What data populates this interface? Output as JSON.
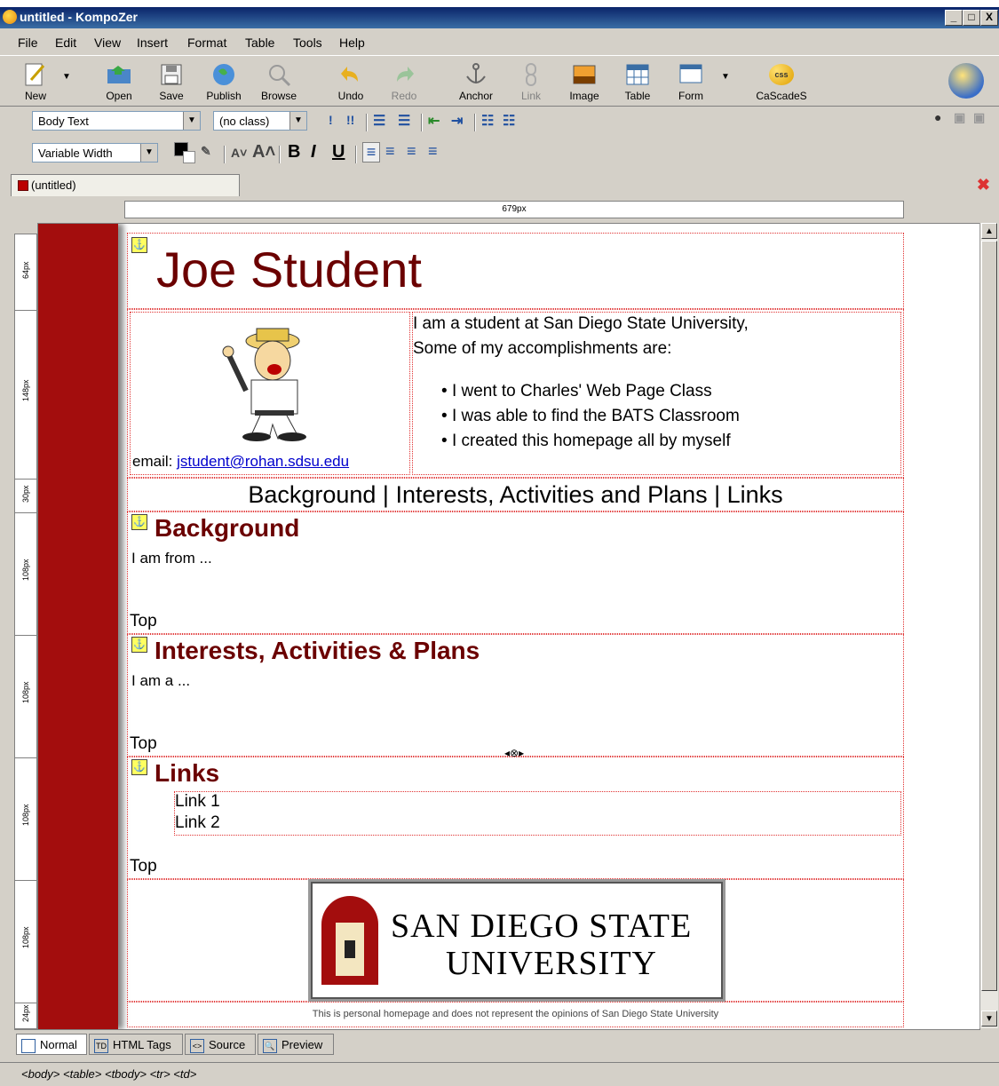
{
  "window": {
    "title": "untitled - KompoZer",
    "min": "_",
    "max": "□",
    "close": "X"
  },
  "menu": [
    "File",
    "Edit",
    "View",
    "Insert",
    "Format",
    "Table",
    "Tools",
    "Help"
  ],
  "toolbar": {
    "new": "New",
    "open": "Open",
    "save": "Save",
    "publish": "Publish",
    "browse": "Browse",
    "undo": "Undo",
    "redo": "Redo",
    "anchor": "Anchor",
    "link": "Link",
    "image": "Image",
    "table": "Table",
    "form": "Form",
    "cascades": "CaScadeS",
    "css_badge": "css"
  },
  "format1": {
    "paragraph_style": "Body Text",
    "class": "(no class)"
  },
  "format2": {
    "font": "Variable Width",
    "bold": "B",
    "italic": "I",
    "underline": "U"
  },
  "tab": {
    "label": "(untitled)"
  },
  "ruler": {
    "width_label": "679px"
  },
  "vruler": [
    "64px",
    "148px",
    "30px",
    "108px",
    "108px",
    "108px",
    "108px",
    "24px"
  ],
  "page": {
    "title": "Joe Student",
    "intro_line1": "I am a student at San Diego State University,",
    "intro_line2": "Some of my accomplishments are:",
    "bullets": [
      "I went to Charles' Web Page Class",
      "I was able to find the BATS Classroom",
      "I created this homepage all by myself"
    ],
    "email_label": "email: ",
    "email": "jstudent@rohan.sdsu.edu",
    "nav": "Background | Interests, Activities and Plans | Links",
    "background_heading": "Background",
    "background_text": "I am from ...",
    "interests_heading": "Interests, Activities & Plans",
    "interests_text": "I am a ...",
    "links_heading": "Links",
    "links": [
      "Link 1",
      "Link 2"
    ],
    "top": "Top",
    "logo_line1": "SAN DIEGO STATE",
    "logo_line2": "UNIVERSITY",
    "footer": "This is personal homepage and does not represent the opinions of San Diego State University"
  },
  "modes": [
    "Normal",
    "HTML Tags",
    "Source",
    "Preview"
  ],
  "status_path": "<body> <table> <tbody> <tr> <td>",
  "colors": {
    "accent": "#a30d0d",
    "heading": "#6b0000",
    "link": "#0000cc"
  }
}
